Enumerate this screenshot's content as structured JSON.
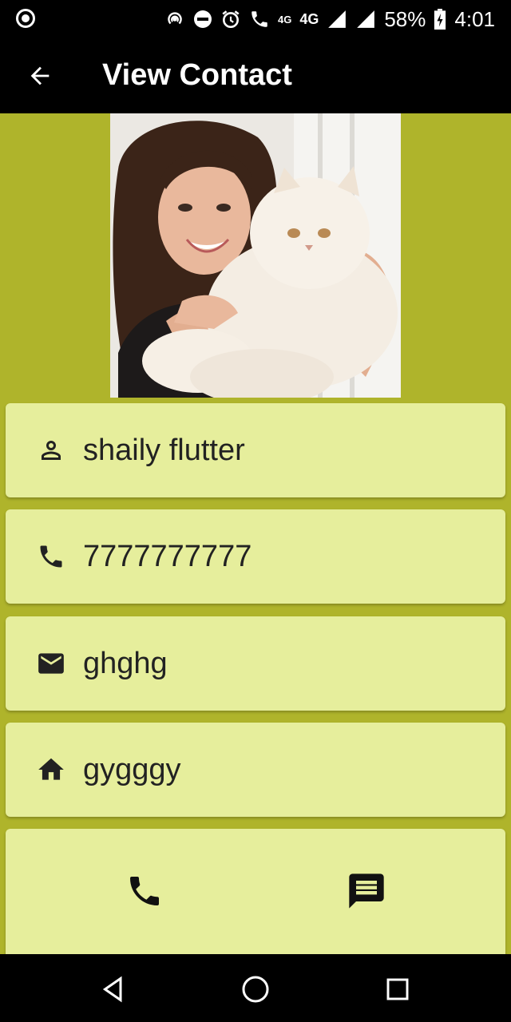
{
  "status_bar": {
    "battery": "58%",
    "network": "4G",
    "volte": "4G",
    "time": "4:01"
  },
  "app_bar": {
    "title": "View Contact"
  },
  "contact": {
    "name": "shaily flutter",
    "phone": "7777777777",
    "email": "ghghg",
    "address": "gygggy"
  },
  "icons": {
    "back": "arrow-back-icon",
    "name": "person-icon",
    "phone": "phone-icon",
    "email": "mail-icon",
    "address": "home-icon",
    "call_action": "phone-icon",
    "message_action": "message-icon",
    "nav_back": "triangle-back-icon",
    "nav_home": "circle-home-icon",
    "nav_recents": "square-recents-icon"
  },
  "colors": {
    "background": "#afb42b",
    "card": "#e6ee9c",
    "app_bar": "#000000"
  }
}
